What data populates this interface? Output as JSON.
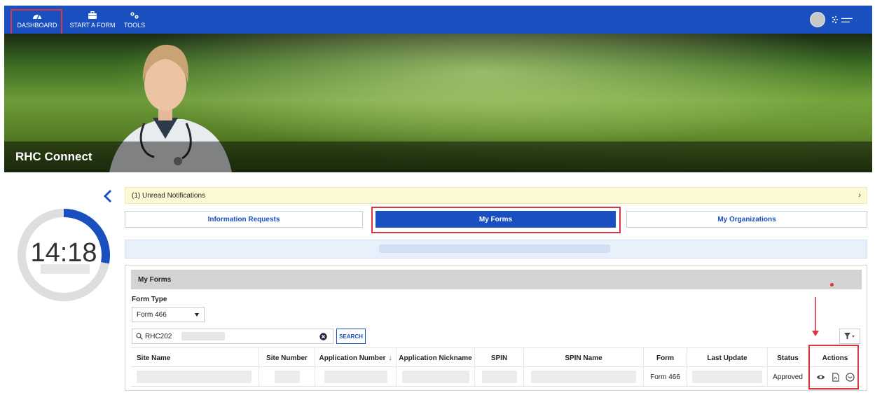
{
  "nav": {
    "items": [
      {
        "label": "DASHBOARD",
        "icon": "dashboard-icon"
      },
      {
        "label": "START A FORM",
        "icon": "briefcase-icon"
      },
      {
        "label": "TOOLS",
        "icon": "tools-icon"
      }
    ]
  },
  "banner": {
    "title": "RHC Connect"
  },
  "timer": {
    "time": "14:18",
    "progress": 0.28
  },
  "notification": {
    "text": "(1) Unread Notifications"
  },
  "tabs": [
    {
      "label": "Information Requests"
    },
    {
      "label": "My Forms",
      "active": true
    },
    {
      "label": "My Organizations"
    }
  ],
  "forms_panel": {
    "header": "My Forms",
    "form_type_label": "Form Type",
    "form_type_value": "Form 466",
    "search_value": "RHC202",
    "search_button": "SEARCH"
  },
  "table": {
    "headers": [
      "Site Name",
      "Site Number",
      "Application Number",
      "Application Nickname",
      "SPIN",
      "SPIN Name",
      "Form",
      "Last Update",
      "Status",
      "Actions"
    ],
    "rows": [
      {
        "form": "Form 466",
        "status": "Approved"
      }
    ],
    "action_icons": [
      "eye-icon",
      "pdf-icon",
      "envelope-icon"
    ]
  },
  "colors": {
    "brand_blue": "#1a4fbf",
    "annotation_red": "#d9363e",
    "notice_yellow": "#fdf9d2"
  }
}
